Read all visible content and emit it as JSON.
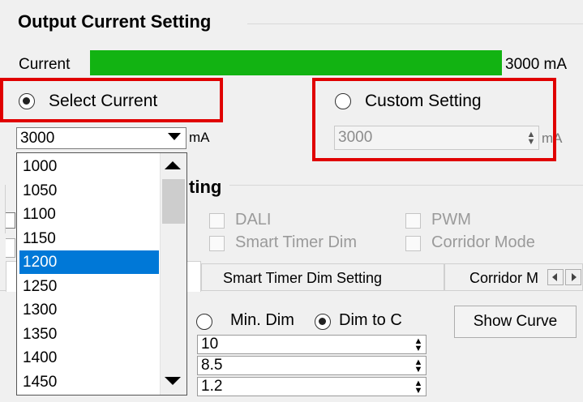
{
  "output_group": {
    "title": "Output Current Setting",
    "current_label": "Current",
    "current_value_text": "3000 mA",
    "current_fraction": 1.0,
    "bar_color": "#12b312"
  },
  "select_current": {
    "label": "Select Current",
    "selected": true,
    "combo_value": "3000",
    "unit": "mA"
  },
  "custom_setting": {
    "label": "Custom Setting",
    "selected": false,
    "value": "3000",
    "unit": "mA"
  },
  "dropdown": {
    "options": [
      "1000",
      "1050",
      "1100",
      "1150",
      "1200",
      "1250",
      "1300",
      "1350",
      "1400",
      "1450"
    ],
    "selected_index": 4
  },
  "dim_group": {
    "title_partial": "ting",
    "options": {
      "dali": "DALI",
      "pwm": "PWM",
      "smart_timer_dim": "Smart Timer Dim",
      "corridor_mode": "Corridor Mode"
    }
  },
  "tabs": {
    "smart_timer": "Smart Timer Dim Setting",
    "corridor": "Corridor M"
  },
  "dim_mode": {
    "min_dim": "Min. Dim",
    "dim_to": "Dim to C",
    "selected": "dim_to"
  },
  "show_curve": "Show Curve",
  "param_values": [
    "10",
    "8.5",
    "1.2"
  ],
  "highlight_color": "#e00000"
}
